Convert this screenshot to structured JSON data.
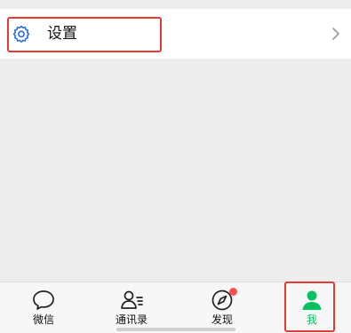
{
  "settings": {
    "label": "设置",
    "icon": "gear-icon",
    "chevron": "chevron-right-icon"
  },
  "tabbar": {
    "items": [
      {
        "label": "微信",
        "icon": "chat-bubble-icon",
        "active": false
      },
      {
        "label": "通讯录",
        "icon": "contacts-icon",
        "active": false
      },
      {
        "label": "发现",
        "icon": "compass-icon",
        "active": false,
        "badge": "dot"
      },
      {
        "label": "我",
        "icon": "person-icon",
        "active": true
      }
    ]
  },
  "colors": {
    "accent": "#07c160",
    "icon_blue": "#2f6fd6",
    "highlight": "#e53935",
    "badge": "#fa5151",
    "background": "#ededed"
  }
}
